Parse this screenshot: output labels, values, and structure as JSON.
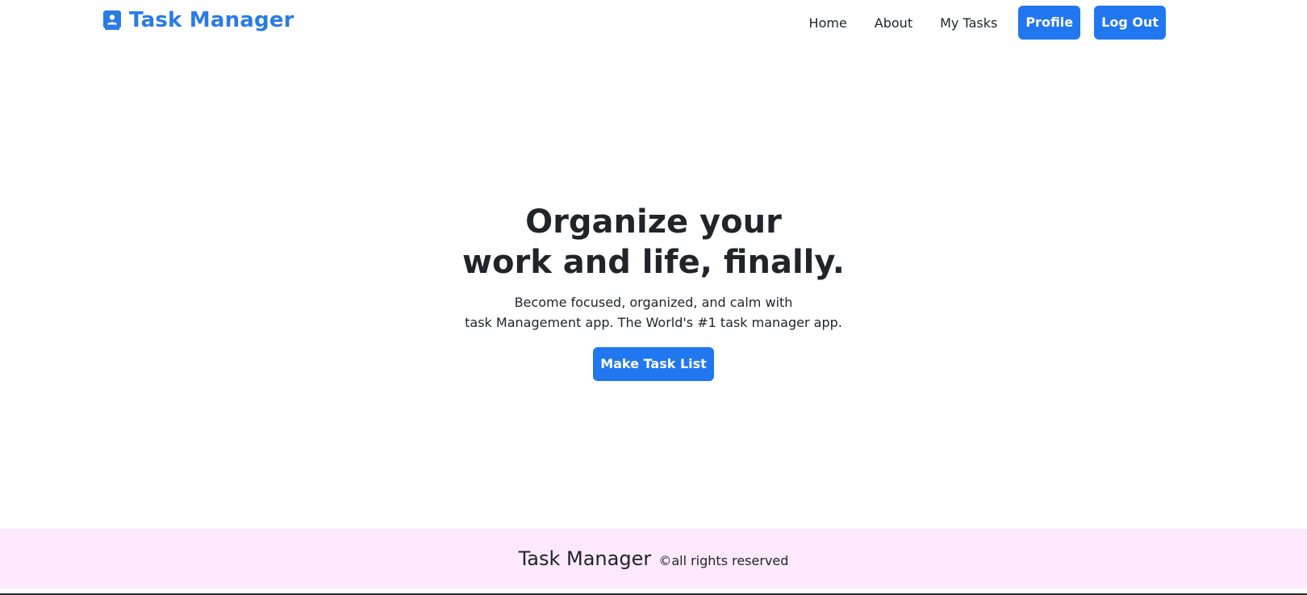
{
  "navbar": {
    "brand": {
      "icon": "person-badge-icon",
      "label": "Task Manager"
    },
    "links": [
      {
        "label": "Home"
      },
      {
        "label": "About"
      },
      {
        "label": "My Tasks"
      }
    ],
    "buttons": {
      "profile_label": "Profile",
      "logout_label": "Log Out"
    }
  },
  "hero": {
    "title_line1": "Organize your",
    "title_line2": "work and life, finally.",
    "subtitle_line1": "Become focused, organized, and calm with",
    "subtitle_line2": "task Management app. The World's #1 task manager app.",
    "cta_label": "Make Task List"
  },
  "footer": {
    "brand": "Task Manager",
    "copyright": "©all rights reserved"
  },
  "colors": {
    "brand_blue": "#2a7be4",
    "button_blue": "#2077ef",
    "footer_bg": "#fde8fd",
    "text": "#212529"
  }
}
